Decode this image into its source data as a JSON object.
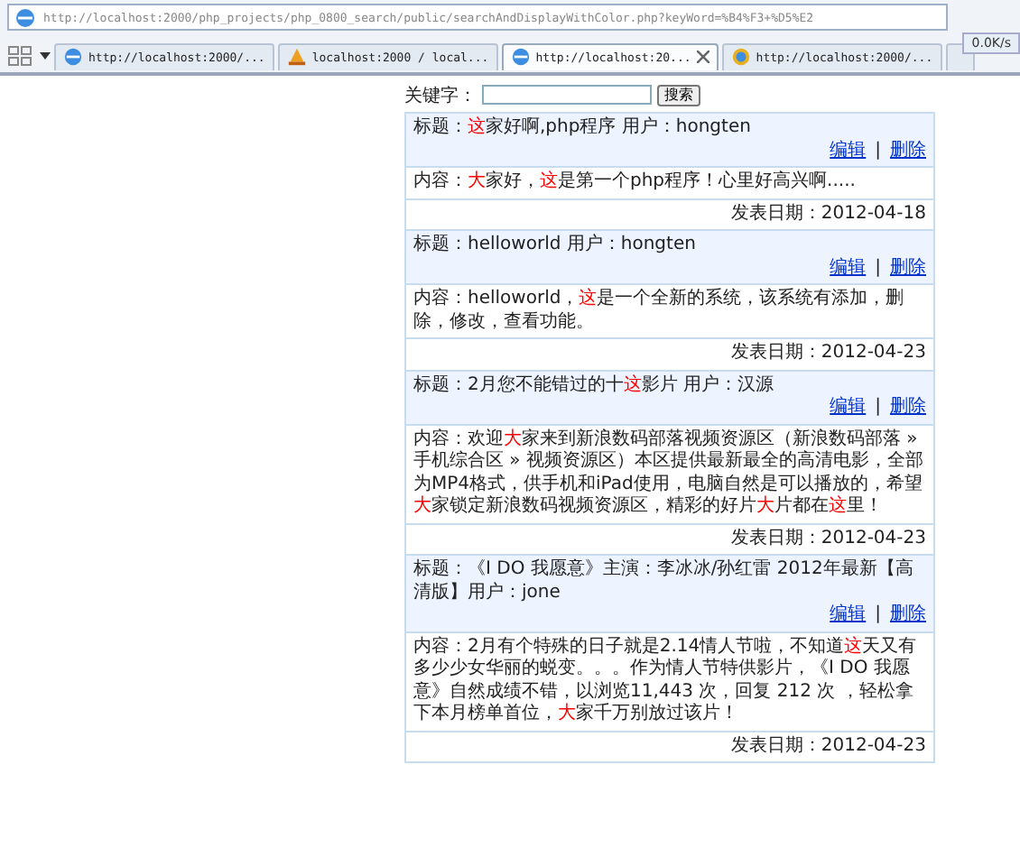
{
  "address_bar": {
    "url": "http://localhost:2000/php_projects/php_0800_search/public/searchAndDisplayWithColor.php?keyWord=%B4%F3+%D5%E2"
  },
  "speed_widget": {
    "text": "0.0K/s"
  },
  "tabs": [
    {
      "title": "http://localhost:2000/...",
      "selected": false
    },
    {
      "title": "localhost:2000 / local...",
      "selected": false
    },
    {
      "title": "http://localhost:20...",
      "selected": true
    },
    {
      "title": "http://localhost:2000/...",
      "selected": false
    }
  ],
  "search": {
    "label": "关键字：",
    "button": "搜索"
  },
  "posts": [
    {
      "title": "标题：**这**家好啊,php程序 用户：hongten",
      "edit": "编辑",
      "separator": "|",
      "delete": "删除",
      "content": "内容：**大**家好，**这**是第一个php程序！心里好高兴啊.....",
      "date": "发表日期：2012-04-18"
    },
    {
      "title": "标题：helloworld 用户：hongten",
      "edit": "编辑",
      "separator": "|",
      "delete": "删除",
      "content": "内容：helloworld，**这**是一个全新的系统，该系统有添加，删除，修改，查看功能。",
      "date": "发表日期：2012-04-23"
    },
    {
      "title": "标题：2月您不能错过的十**这**影片 用户：汉源",
      "edit": "编辑",
      "separator": "|",
      "delete": "删除",
      "content": "内容：欢迎**大**家来到新浪数码部落视频资源区（新浪数码部落 » 手机综合区 » 视频资源区）本区提供最新最全的高清电影，全部为MP4格式，供手机和iPad使用，电脑自然是可以播放的，希望**大**家锁定新浪数码视频资源区，精彩的好片**大**片都在**这**里！",
      "date": "发表日期：2012-04-23"
    },
    {
      "title": "标题：《I DO 我愿意》主演：李冰冰/孙红雷 2012年最新【高清版】用户：jone",
      "edit": "编辑",
      "separator": "|",
      "delete": "删除",
      "content": "内容：2月有个特殊的日子就是2.14情人节啦，不知道**这**天又有多少少女华丽的蜕变。。。作为情人节特供影片，《I DO 我愿意》自然成绩不错，以浏览11,443 次，回复 212 次 ，轻松拿下本月榜单首位，**大**家千万别放过该片！",
      "date": "发表日期：2012-04-23"
    }
  ]
}
